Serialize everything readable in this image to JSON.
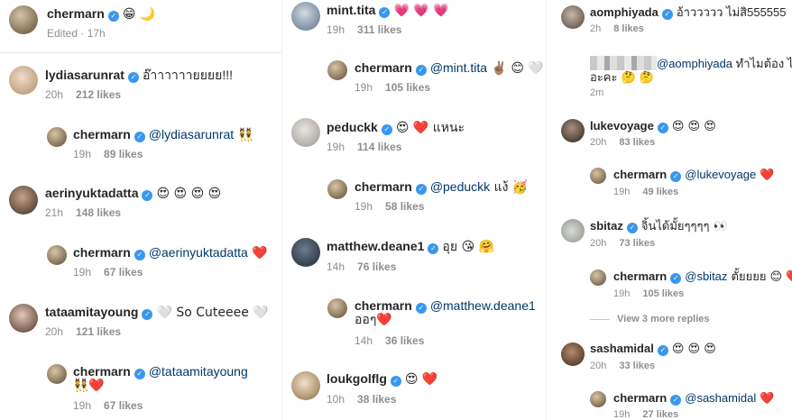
{
  "caption": {
    "user": "chermarn",
    "text": "😁 🌙",
    "meta": "Edited · 17h"
  },
  "col1": [
    {
      "user": "lydiasarunrat",
      "text": "อ๊าาาาาายยยย!!!",
      "time": "20h",
      "likes": "212 likes"
    },
    {
      "user": "chermarn",
      "mention": "@lydiasarunrat",
      "text": " 👯",
      "time": "19h",
      "likes": "89 likes"
    },
    {
      "user": "aerinyuktadatta",
      "text": "😍 😍 😍 😍",
      "time": "21h",
      "likes": "148 likes"
    },
    {
      "user": "chermarn",
      "mention": "@aerinyuktadatta",
      "text": " ❤️",
      "time": "19h",
      "likes": "67 likes"
    },
    {
      "user": "tataamitayoung",
      "text": "🤍 So Cuteeee 🤍",
      "time": "20h",
      "likes": "121 likes"
    },
    {
      "user": "chermarn",
      "mention": "@tataamitayoung",
      "text": "👯❤️",
      "time": "19h",
      "likes": "67 likes"
    }
  ],
  "col2": [
    {
      "user": "mint.tita",
      "text": "💗 💗 💗",
      "time": "19h",
      "likes": "311 likes"
    },
    {
      "user": "chermarn",
      "mention": "@mint.tita",
      "text": " ✌🏽 😊 🤍",
      "time": "19h",
      "likes": "105 likes"
    },
    {
      "user": "peduckk",
      "text": "😍 ❤️ แหนะ",
      "time": "19h",
      "likes": "114 likes"
    },
    {
      "user": "chermarn",
      "mention": "@peduckk",
      "text": " แง้ 🥳",
      "time": "19h",
      "likes": "58 likes"
    },
    {
      "user": "matthew.deane1",
      "text": "อุย 😘 🤗",
      "time": "14h",
      "likes": "76 likes"
    },
    {
      "user": "chermarn",
      "mention": "@matthew.deane1",
      "text": "ออๆ❤️",
      "time": "14h",
      "likes": "36 likes"
    },
    {
      "user": "loukgolflg",
      "text": "😍 ❤️",
      "time": "10h",
      "likes": "38 likes"
    }
  ],
  "col3": [
    {
      "user": "aomphiyada",
      "text": "อ้าววววว ไม่สิ555555",
      "time": "2h",
      "likes": "8 likes"
    },
    {
      "user": "",
      "mention": "@aomphiyada",
      "text": " ทำไมต้อง ไม่",
      "text2": "อะคะ 🤔 🤔",
      "time": "2m",
      "likes": ""
    },
    {
      "user": "lukevoyage",
      "text": "😍 😍 😍",
      "time": "20h",
      "likes": "83 likes"
    },
    {
      "user": "chermarn",
      "mention": "@lukevoyage",
      "text": " ❤️",
      "time": "19h",
      "likes": "49 likes"
    },
    {
      "user": "sbitaz",
      "text": "จิ้นได้มั้ยๆๆๆๆ 👀",
      "time": "20h",
      "likes": "73 likes"
    },
    {
      "user": "chermarn",
      "mention": "@sbitaz",
      "text": " ตั้ยยยย 😊 ❤️",
      "time": "19h",
      "likes": "105 likes"
    },
    {
      "user": "sashamidal",
      "text": "😍 😍 😍",
      "time": "20h",
      "likes": "33 likes"
    },
    {
      "user": "chermarn",
      "mention": "@sashamidal",
      "text": " ❤️",
      "time": "19h",
      "likes": "27 likes"
    }
  ],
  "view_more": "View 3 more replies",
  "colors": {
    "text": "#262626",
    "meta": "#8e8e8e",
    "mention": "#00376b",
    "verified": "#3897f0"
  }
}
